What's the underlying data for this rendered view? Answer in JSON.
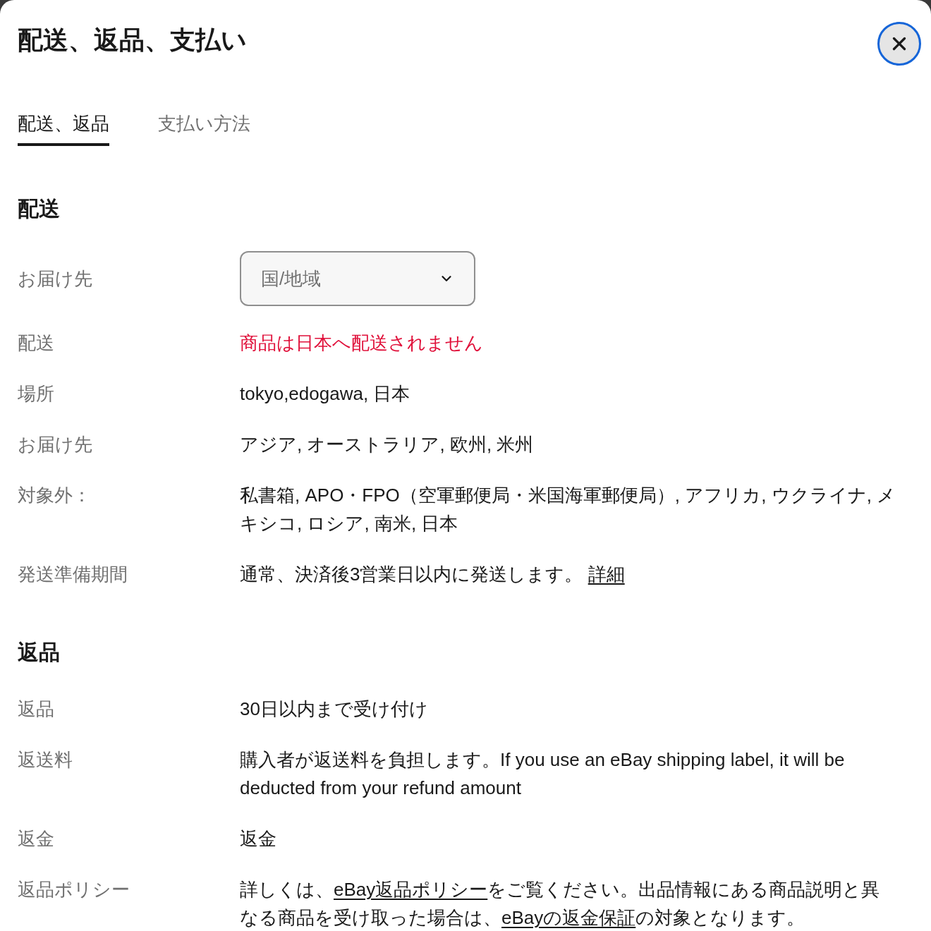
{
  "dialog": {
    "title": "配送、返品、支払い"
  },
  "tabs": [
    {
      "label": "配送、返品",
      "selected": true
    },
    {
      "label": "支払い方法",
      "selected": false
    }
  ],
  "sections": [
    {
      "heading": "配送",
      "rows": [
        {
          "label": "お届け先",
          "kind": "select",
          "placeholder": "国/地域"
        },
        {
          "label": "配送",
          "kind": "alert",
          "parts": [
            {
              "kind": "text",
              "text": "商品は日本へ配送されません"
            }
          ]
        },
        {
          "label": "場所",
          "kind": "text",
          "parts": [
            {
              "kind": "text",
              "text": "tokyo,edogawa, 日本"
            }
          ]
        },
        {
          "label": "お届け先",
          "kind": "text",
          "parts": [
            {
              "kind": "text",
              "text": "アジア, オーストラリア, 欧州, 米州"
            }
          ]
        },
        {
          "label": "対象外：",
          "kind": "text",
          "parts": [
            {
              "kind": "text",
              "text": "私書箱, APO・FPO（空軍郵便局・米国海軍郵便局）, アフリカ, ウクライナ, メキシコ, ロシア, 南米, 日本"
            }
          ]
        },
        {
          "label": "発送準備期間",
          "kind": "text",
          "parts": [
            {
              "kind": "text",
              "text": "通常、決済後3営業日以内に発送します。 "
            },
            {
              "kind": "link",
              "text": "詳細"
            }
          ]
        }
      ]
    },
    {
      "heading": "返品",
      "rows": [
        {
          "label": "返品",
          "kind": "text",
          "parts": [
            {
              "kind": "text",
              "text": "30日以内まで受け付け"
            }
          ]
        },
        {
          "label": "返送料",
          "kind": "text",
          "parts": [
            {
              "kind": "text",
              "text": "購入者が返送料を負担します。If you use an eBay shipping label, it will be deducted from your refund amount"
            }
          ]
        },
        {
          "label": "返金",
          "kind": "text",
          "parts": [
            {
              "kind": "text",
              "text": "返金"
            }
          ]
        },
        {
          "label": "返品ポリシー",
          "kind": "text",
          "parts": [
            {
              "kind": "text",
              "text": "詳しくは、"
            },
            {
              "kind": "link",
              "text": "eBay返品ポリシー"
            },
            {
              "kind": "text",
              "text": "をご覧ください。出品情報にある商品説明と異なる商品を受け取った場合は、"
            },
            {
              "kind": "link",
              "text": "eBayの返金保証"
            },
            {
              "kind": "text",
              "text": "の対象となります。"
            }
          ]
        }
      ]
    }
  ]
}
